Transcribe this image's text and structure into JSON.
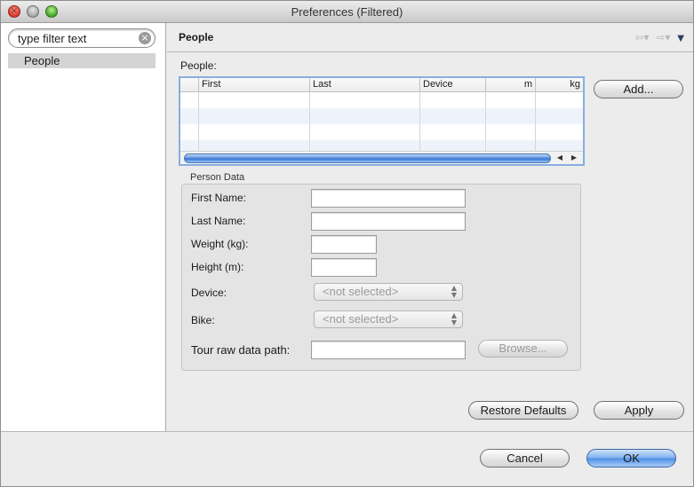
{
  "window": {
    "title": "Preferences (Filtered)"
  },
  "sidebar": {
    "filter": {
      "value": "type filter text"
    },
    "items": [
      {
        "label": "People"
      }
    ]
  },
  "page": {
    "title": "People",
    "people_label": "People:",
    "table": {
      "columns": [
        "",
        "First",
        "Last",
        "Device",
        "m",
        "kg"
      ],
      "rows": []
    },
    "add_button": "Add...",
    "person_data": {
      "title": "Person Data",
      "first_name_label": "First Name:",
      "last_name_label": "Last Name:",
      "weight_label": "Weight (kg):",
      "height_label": "Height (m):",
      "device_label": "Device:",
      "device_value": "<not selected>",
      "bike_label": "Bike:",
      "bike_value": "<not selected>",
      "tour_path_label": "Tour raw data path:",
      "browse_button": "Browse..."
    },
    "restore_defaults_button": "Restore Defaults",
    "apply_button": "Apply"
  },
  "footer": {
    "cancel_button": "Cancel",
    "ok_button": "OK"
  },
  "colors": {
    "accent": "#4d8ee6",
    "selection": "#d4d4d4"
  }
}
